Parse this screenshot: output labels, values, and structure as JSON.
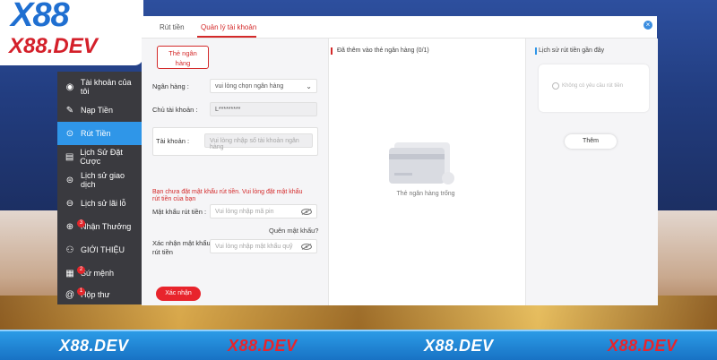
{
  "logo": {
    "line1": "X88",
    "line2": "X88.DEV"
  },
  "sidebar": {
    "items": [
      {
        "label": "Tài khoản của tôi",
        "icon": "account-icon"
      },
      {
        "label": "Nạp Tiền",
        "icon": "deposit-icon"
      },
      {
        "label": "Rút Tiền",
        "icon": "withdraw-icon",
        "active": true
      },
      {
        "label": "Lịch Sử Đặt Cược",
        "icon": "bet-history-icon"
      },
      {
        "label": "Lịch sử giao dịch",
        "icon": "transaction-history-icon"
      },
      {
        "label": "Lịch sử lãi lỗ",
        "icon": "profit-loss-icon"
      },
      {
        "label": "Nhận Thưởng",
        "icon": "reward-icon",
        "badge": "3"
      },
      {
        "label": "GIỚI THIỆU",
        "icon": "referral-icon"
      },
      {
        "label": "Sứ mệnh",
        "icon": "mission-icon",
        "badge": "2"
      },
      {
        "label": "Hộp thư",
        "icon": "mailbox-icon",
        "badge": "1"
      }
    ]
  },
  "modal": {
    "tabs": [
      {
        "label": "Rút tiền"
      },
      {
        "label": "Quản lý tài khoản",
        "active": true
      }
    ],
    "close_label": "×"
  },
  "form": {
    "bank_tab_label_1": "Thẻ ngân",
    "bank_tab_label_2": "hàng",
    "bank_label": "Ngân hàng :",
    "bank_select_value": "vui lòng chọn ngân hàng",
    "holder_label": "Chủ tài khoản :",
    "holder_value": "L*********",
    "account_label": "Tài khoản :",
    "account_placeholder": "Vui lòng nhập số tài khoản ngân hàng",
    "error_text": "Bạn chưa đặt mật khẩu rút tiền. Vui lòng đặt mật khẩu rút tiền của bạn",
    "pin_label": "Mật khẩu rút tiền :",
    "pin_placeholder": "Vui lòng nhập mã pin",
    "forgot_label": "Quên mật khẩu?",
    "confirm_pin_label_1": "Xác nhận mật khẩu",
    "confirm_pin_label_2": "rút tiền",
    "confirm_pin_placeholder": "Vui lòng nhập mật khẩu quỹ",
    "submit_label": "Xác nhận"
  },
  "bank_list": {
    "title": "Đã thêm vào thẻ ngân hàng  (0/1)",
    "empty_text": "Thẻ ngân hàng trống"
  },
  "recent": {
    "title": "Lịch sử rút tiền gần đây",
    "empty_text": "Không có yêu cầu rút tiền",
    "more_label": "Thêm"
  },
  "banner": {
    "items": [
      {
        "text": "X88.DEV",
        "color": "#ffffff"
      },
      {
        "text": "X88.DEV",
        "color": "#e8242c"
      },
      {
        "text": "X88.DEV",
        "color": "#ffffff"
      },
      {
        "text": "X88.DEV",
        "color": "#e8242c"
      }
    ]
  },
  "colors": {
    "accent": "#d42a2a",
    "active_blue": "#2f96e8",
    "sidebar_bg": "#3a3a3f"
  }
}
